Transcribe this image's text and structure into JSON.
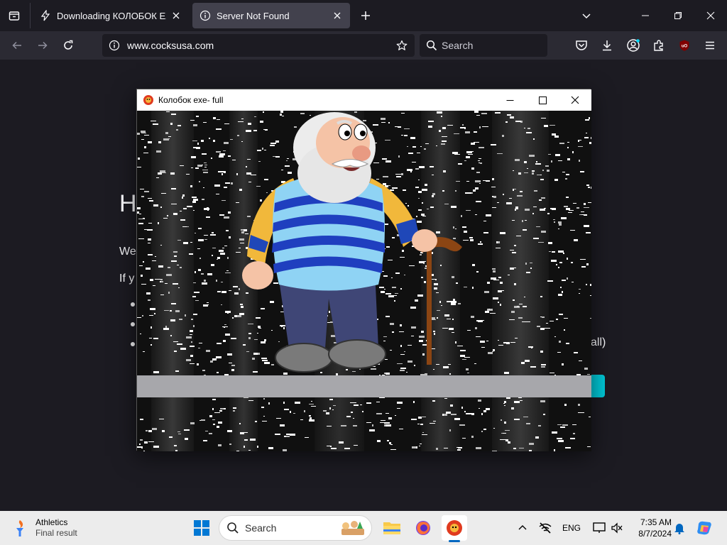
{
  "browser": {
    "tabs": [
      {
        "title": "Downloading КОЛОБОК EXE fu",
        "icon": "bolt-icon",
        "active": false
      },
      {
        "title": "Server Not Found",
        "icon": "info-icon",
        "active": true
      }
    ],
    "url": "www.cocksusa.com",
    "search_placeholder": "Search"
  },
  "page": {
    "heading_fragment": "H",
    "p1_fragment": "We",
    "p2_fragment": "If y",
    "tail_fragment": "vall)"
  },
  "game_window": {
    "title": "Колобок exe- full",
    "icon": "kolobok-app-icon"
  },
  "taskbar": {
    "widget_title": "Athletics",
    "widget_subtitle": "Final result",
    "search_placeholder": "Search",
    "language": "ENG",
    "time": "7:35 AM",
    "date": "8/7/2024"
  },
  "colors": {
    "accent": "#00c8d7",
    "browser_bg": "#1c1b22",
    "toolbar_bg": "#2b2a33",
    "taskbar_bg": "#ececec"
  }
}
